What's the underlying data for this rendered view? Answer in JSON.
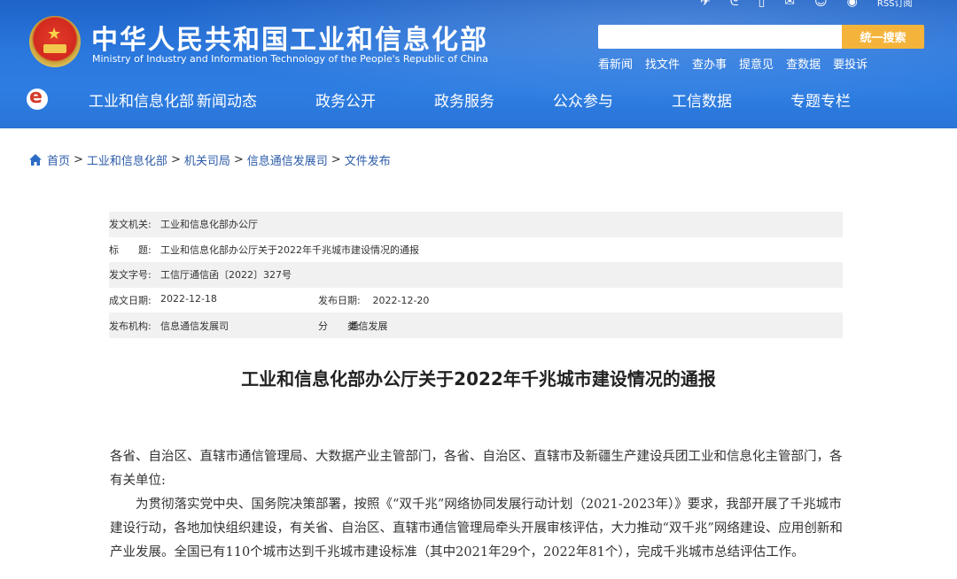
{
  "header": {
    "title_cn": "中华人民共和国工业和信息化部",
    "title_en": "Ministry of Industry and Information Technology of the People's Republic of China",
    "rss_label": "RSS订阅",
    "search_placeholder": "",
    "search_button": "统一搜索",
    "quick_links": [
      "看新闻",
      "找文件",
      "查办事",
      "提意见",
      "查数据",
      "要投诉"
    ],
    "icons": [
      "share-icon",
      "weibo-icon",
      "mobile-icon",
      "mail-icon",
      "wechat-icon",
      "weibo-round-icon",
      "rss-icon"
    ]
  },
  "nav": [
    "工业和信息化部",
    "新闻动态",
    "政务公开",
    "政务服务",
    "公众参与",
    "工信数据",
    "专题专栏"
  ],
  "breadcrumb": [
    "首页",
    "工业和信息化部",
    "机关司局",
    "信息通信发展司",
    "文件发布"
  ],
  "meta": {
    "issuer_label": "发文机关:",
    "issuer": "工业和信息化部办公厅",
    "title_label": "标　　题:",
    "title": "工业和信息化部办公厅关于2022年千兆城市建设情况的通报",
    "doc_no_label": "发文字号:",
    "doc_no": "工信厅通信函〔2022〕327号",
    "created_label": "成文日期:",
    "created": "2022-12-18",
    "published_label": "发布日期:",
    "published": "2022-12-20",
    "org_label": "发布机构:",
    "org": "信息通信发展司",
    "category_label": "分　　类:",
    "category": "通信发展"
  },
  "doc": {
    "title": "工业和信息化部办公厅关于2022年千兆城市建设情况的通报",
    "salutation": "各省、自治区、直辖市通信管理局、大数据产业主管部门，各省、自治区、直辖市及新疆生产建设兵团工业和信息化主管部门，各有关单位:",
    "paragraph1": "为贯彻落实党中央、国务院决策部署，按照《“双千兆”网络协同发展行动计划（2021-2023年）》要求，我部开展了千兆城市建设行动，各地加快组织建设，有关省、自治区、直辖市通信管理局牵头开展审核评估，大力推动“双千兆”网络建设、应用创新和产业发展。全国已有110个城市达到千兆城市建设标准（其中2021年29个，2022年81个），完成千兆城市总结评估工作。"
  },
  "colors": {
    "header_blue": "#2a77dd",
    "search_button": "#f4b43c",
    "link_blue": "#2b5ba8",
    "meta_stripe": "#f1f1f1"
  }
}
